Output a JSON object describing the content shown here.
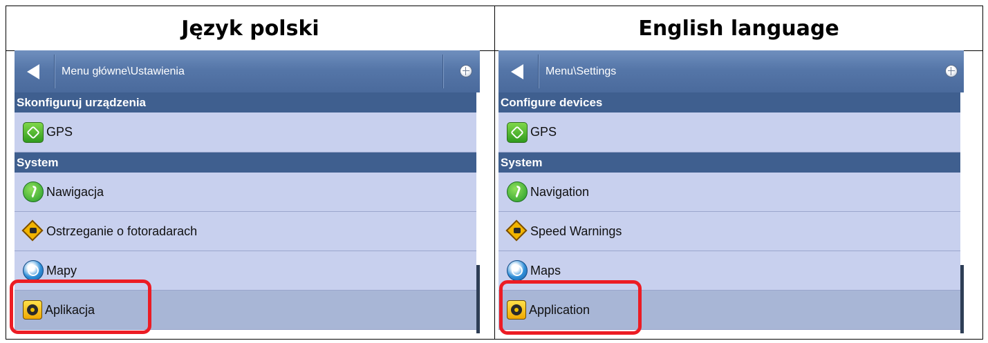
{
  "headers": {
    "left": "Język polski",
    "right": "English language"
  },
  "panels": {
    "left": {
      "path": "Menu główne\\Ustawienia",
      "sections": {
        "devices": "Skonfiguruj urządzenia",
        "system": "System"
      },
      "items": {
        "gps": "GPS",
        "navigation": "Nawigacja",
        "speed": "Ostrzeganie o fotoradarach",
        "maps": "Mapy",
        "application": "Aplikacja"
      }
    },
    "right": {
      "path": "Menu\\Settings",
      "sections": {
        "devices": "Configure devices",
        "system": "System"
      },
      "items": {
        "gps": "GPS",
        "navigation": "Navigation",
        "speed": "Speed Warnings",
        "maps": "Maps",
        "application": "Application"
      }
    }
  },
  "colors": {
    "titlebar": "#5576a8",
    "section": "#3f5f8f",
    "item": "#c8d0ee",
    "selected_item": "#a8b6d6",
    "highlight": "#ec1c24"
  },
  "icons": [
    "back-arrow-icon",
    "globe-icon",
    "gps-icon",
    "navigation-icon",
    "speed-camera-icon",
    "maps-icon",
    "application-gear-icon"
  ]
}
